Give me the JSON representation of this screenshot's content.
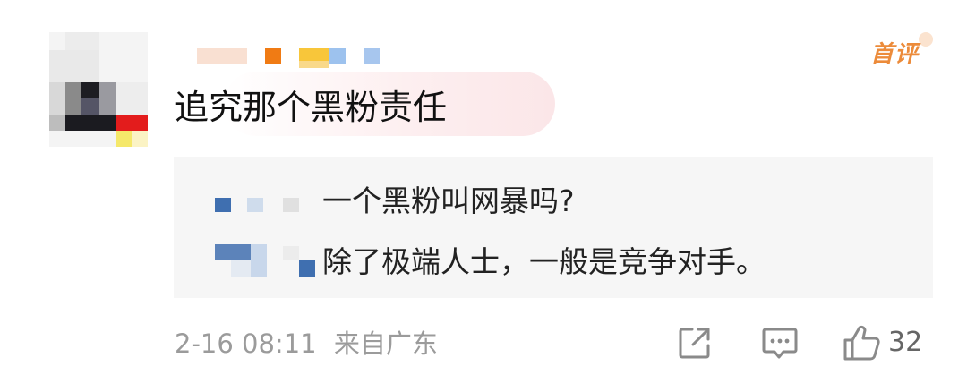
{
  "badge": {
    "label": "首评",
    "color": "#ec8b3a"
  },
  "comment": {
    "text": "追究那个黑粉责任"
  },
  "replies": [
    {
      "text": "一个黑粉叫网暴吗?"
    },
    {
      "text": "除了极端人士，一般是竞争对手。"
    }
  ],
  "footer": {
    "timestamp": "2-16 08:11",
    "location": "来自广东",
    "share_icon": "share-icon",
    "comment_icon": "comment-icon",
    "like_icon": "thumbs-up-icon",
    "like_count": "32"
  },
  "colors": {
    "reply_background": "#f6f6f6",
    "meta_text": "#9b9b9b",
    "highlight": "#fbe6e8"
  }
}
